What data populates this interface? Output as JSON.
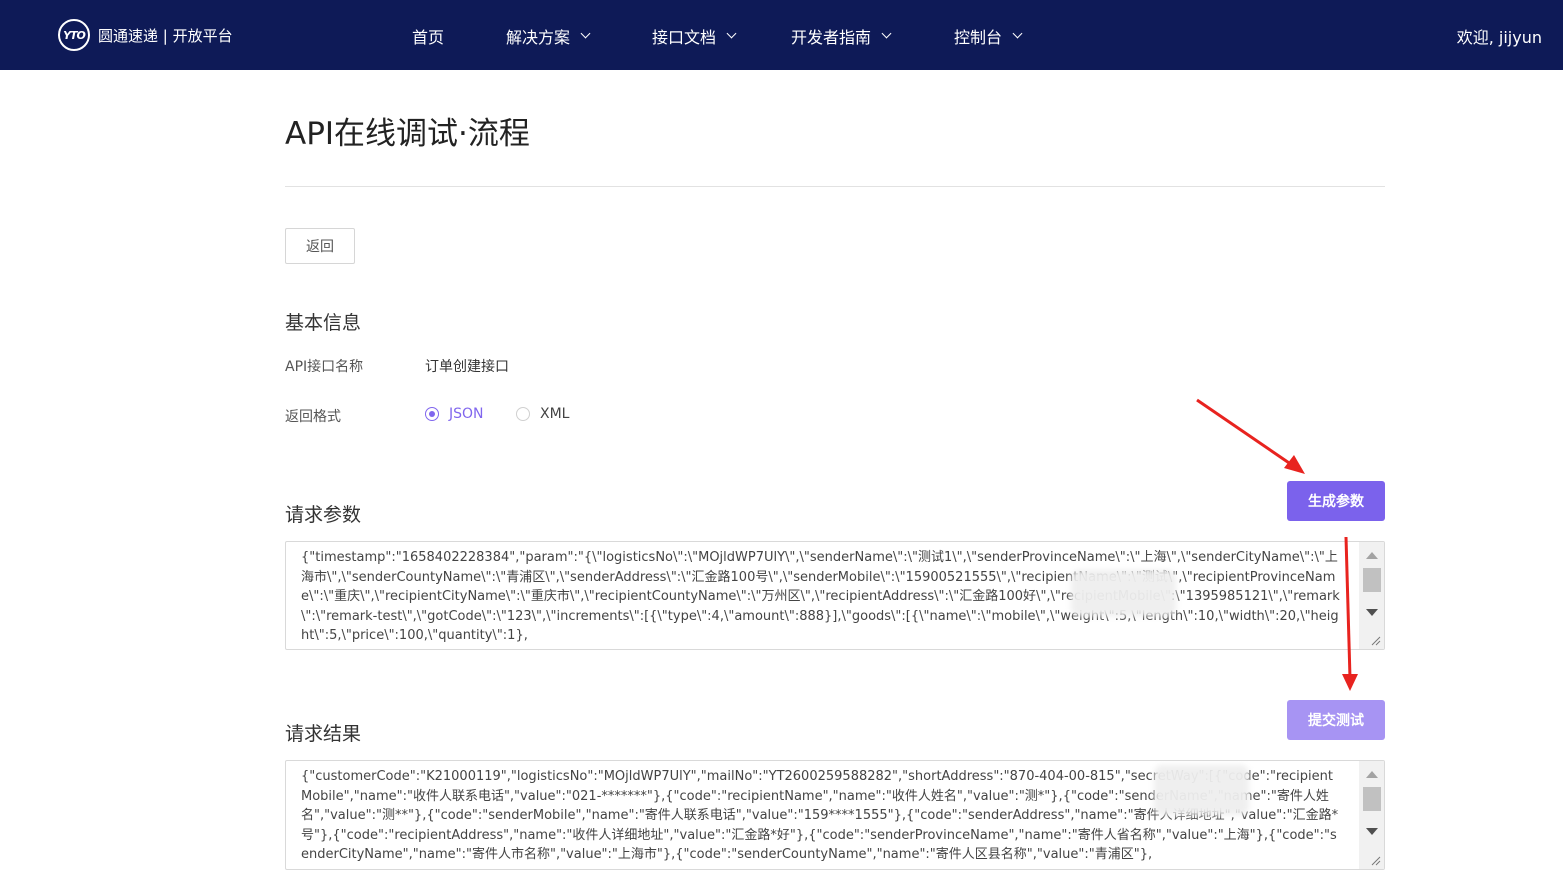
{
  "nav": {
    "logo_mark": "YTO",
    "brand": "圆通速递 | 开放平台",
    "items": [
      {
        "label": "首页",
        "has_dropdown": false
      },
      {
        "label": "解决方案",
        "has_dropdown": true
      },
      {
        "label": "接口文档",
        "has_dropdown": true
      },
      {
        "label": "开发者指南",
        "has_dropdown": true
      },
      {
        "label": "控制台",
        "has_dropdown": true
      }
    ],
    "user_greeting": "欢迎, jijyun"
  },
  "page": {
    "title": "API在线调试·流程",
    "back_label": "返回"
  },
  "basic_info": {
    "section_title": "基本信息",
    "api_name_label": "API接口名称",
    "api_name_value": "订单创建接口",
    "format_label": "返回格式",
    "format_options": [
      {
        "label": "JSON",
        "selected": true
      },
      {
        "label": "XML",
        "selected": false
      }
    ]
  },
  "request_params": {
    "section_title": "请求参数",
    "generate_button": "生成参数",
    "content": "{\"timestamp\":\"1658402228384\",\"param\":\"{\\\"logisticsNo\\\":\\\"MOjldWP7UlY\\\",\\\"senderName\\\":\\\"测试1\\\",\\\"senderProvinceName\\\":\\\"上海\\\",\\\"senderCityName\\\":\\\"上海市\\\",\\\"senderCountyName\\\":\\\"青浦区\\\",\\\"senderAddress\\\":\\\"汇金路100号\\\",\\\"senderMobile\\\":\\\"15900521555\\\",\\\"recipientName\\\":\\\"测试\\\",\\\"recipientProvinceName\\\":\\\"重庆\\\",\\\"recipientCityName\\\":\\\"重庆市\\\",\\\"recipientCountyName\\\":\\\"万州区\\\",\\\"recipientAddress\\\":\\\"汇金路100好\\\",\\\"recipientMobile\\\":\\\"1395985121\\\",\\\"remark\\\":\\\"remark-test\\\",\\\"gotCode\\\":\\\"123\\\",\\\"increments\\\":[{\\\"type\\\":4,\\\"amount\\\":888}],\\\"goods\\\":[{\\\"name\\\":\\\"mobile\\\",\\\"weight\\\":5,\\\"length\\\":10,\\\"width\\\":20,\\\"height\\\":5,\\\"price\\\":100,\\\"quantity\\\":1},"
  },
  "request_result": {
    "section_title": "请求结果",
    "submit_button": "提交测试",
    "content": "{\"customerCode\":\"K21000119\",\"logisticsNo\":\"MOjldWP7UlY\",\"mailNo\":\"YT2600259588282\",\"shortAddress\":\"870-404-00-815\",\"secretWay\":[{\"code\":\"recipientMobile\",\"name\":\"收件人联系电话\",\"value\":\"021-*******\"},{\"code\":\"recipientName\",\"name\":\"收件人姓名\",\"value\":\"测*\"},{\"code\":\"senderName\",\"name\":\"寄件人姓名\",\"value\":\"测**\"},{\"code\":\"senderMobile\",\"name\":\"寄件人联系电话\",\"value\":\"159****1555\"},{\"code\":\"senderAddress\",\"name\":\"寄件人详细地址\",\"value\":\"汇金路*号\"},{\"code\":\"recipientAddress\",\"name\":\"收件人详细地址\",\"value\":\"汇金路*好\"},{\"code\":\"senderProvinceName\",\"name\":\"寄件人省名称\",\"value\":\"上海\"},{\"code\":\"senderCityName\",\"name\":\"寄件人市名称\",\"value\":\"上海市\"},{\"code\":\"senderCountyName\",\"name\":\"寄件人区县名称\",\"value\":\"青浦区\"},"
  },
  "colors": {
    "nav_bg": "#0e1a57",
    "accent": "#7b62ec",
    "accent_disabled": "#a794f3",
    "annotation_arrow": "#e8231f"
  }
}
